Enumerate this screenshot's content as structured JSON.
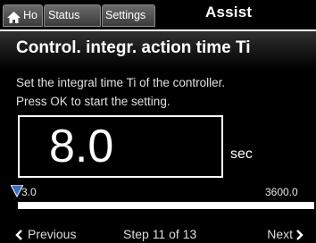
{
  "topbar": {
    "tabs": [
      {
        "label": "Ho",
        "icon": "home-icon"
      },
      {
        "label": "Status"
      },
      {
        "label": "Settings"
      }
    ],
    "assist_label": "Assist"
  },
  "header": {
    "title": "Control. integr. action time Ti"
  },
  "description": {
    "line1": "Set the integral time Ti of the controller.",
    "line2": "Press OK to start the setting."
  },
  "value": {
    "current": "8.0",
    "unit": "sec"
  },
  "slider": {
    "min_label": "3.0",
    "max_label": "3600.0",
    "level_fraction": 0.0014
  },
  "footer": {
    "previous_label": "Previous",
    "step_label": "Step 11 of 13",
    "next_label": "Next"
  },
  "colors": {
    "background": "#000000",
    "foreground": "#ffffff",
    "tab_bg": "#555555",
    "marker": "#3a6fc0"
  }
}
